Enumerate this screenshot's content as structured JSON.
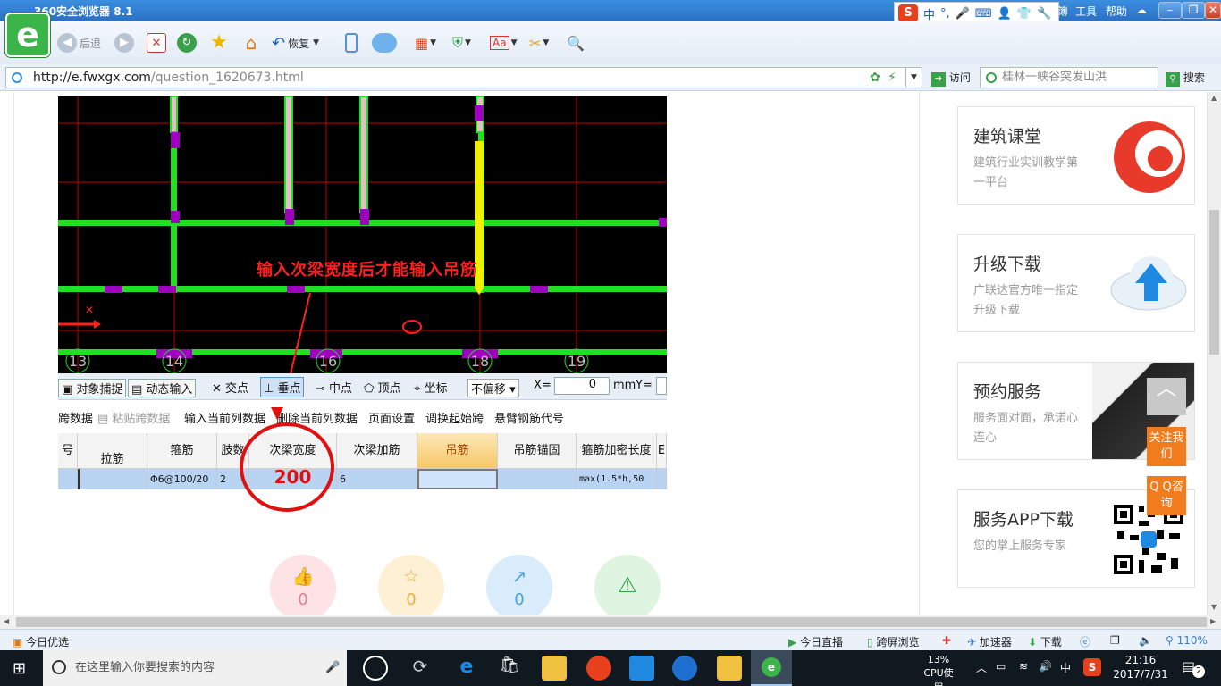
{
  "window": {
    "title": "360安全浏览器 8.1",
    "menu": [
      "工具",
      "帮助"
    ],
    "menu_partial": "簿"
  },
  "ime": {
    "items": [
      "中",
      "°,"
    ]
  },
  "toolbar": {
    "back": "后退",
    "restore": "恢复"
  },
  "address": {
    "host": "http://e.fwxgx.com",
    "path": "/question_1620673.html",
    "go": "访问",
    "search_value": "桂林一峡谷突发山洪",
    "search_btn": "搜索"
  },
  "cad": {
    "annotation": "输入次梁宽度后才能输入吊筋",
    "axis_labels": [
      "13",
      "14",
      "16",
      "18",
      "19"
    ],
    "toolbar": [
      "对象捕捉",
      "动态输入",
      "交点",
      "垂点",
      "中点",
      "顶点",
      "坐标",
      "不偏移",
      "X=",
      "0",
      "mm",
      "Y="
    ],
    "menu": [
      "跨数据",
      "粘贴跨数据",
      "输入当前列数据",
      "删除当前列数据",
      "页面设置",
      "调换起始跨",
      "悬臂钢筋代号"
    ],
    "grid_headers": [
      "号",
      "拉筋",
      "箍筋",
      "肢数",
      "次梁宽度",
      "次梁加筋",
      "吊筋",
      "吊筋锚固",
      "箍筋加密长度",
      "E"
    ],
    "grid_row": [
      "",
      "",
      "Φ6@100/20",
      "2",
      "200",
      "6",
      "",
      "",
      "max(1.5*h,50",
      ""
    ],
    "highlight_value": "200"
  },
  "reactions": [
    {
      "name": "like",
      "count": "0"
    },
    {
      "name": "favorite",
      "count": "0"
    },
    {
      "name": "share",
      "count": "0"
    },
    {
      "name": "report",
      "count": ""
    }
  ],
  "sidebar": [
    {
      "title": "建筑课堂",
      "sub": "建筑行业实训教学第一平台"
    },
    {
      "title": "升级下载",
      "sub": "广联达官方唯一指定升级下载"
    },
    {
      "title": "预约服务",
      "sub": "服务面对面，承诺心连心"
    },
    {
      "title": "服务APP下载",
      "sub": "您的掌上服务专家"
    }
  ],
  "float": {
    "follow": "关注我们",
    "qq": "Q Q咨询"
  },
  "statusbar": {
    "left": "今日优选",
    "live": "今日直播",
    "split": "跨屏浏览",
    "accel": "加速器",
    "download": "下载",
    "zoom": "110%"
  },
  "taskbar": {
    "search_placeholder": "在这里输入你要搜索的内容",
    "cpu": "13%",
    "cpu_label": "CPU使用",
    "ime": "中",
    "time": "21:16",
    "date": "2017/7/31",
    "notif": "2"
  },
  "colors": {
    "accent": "#2a6fc4",
    "cad_bg": "#000000",
    "beam": "#00ff00",
    "annotation": "#ff2020",
    "orange": "#f07c1e"
  }
}
